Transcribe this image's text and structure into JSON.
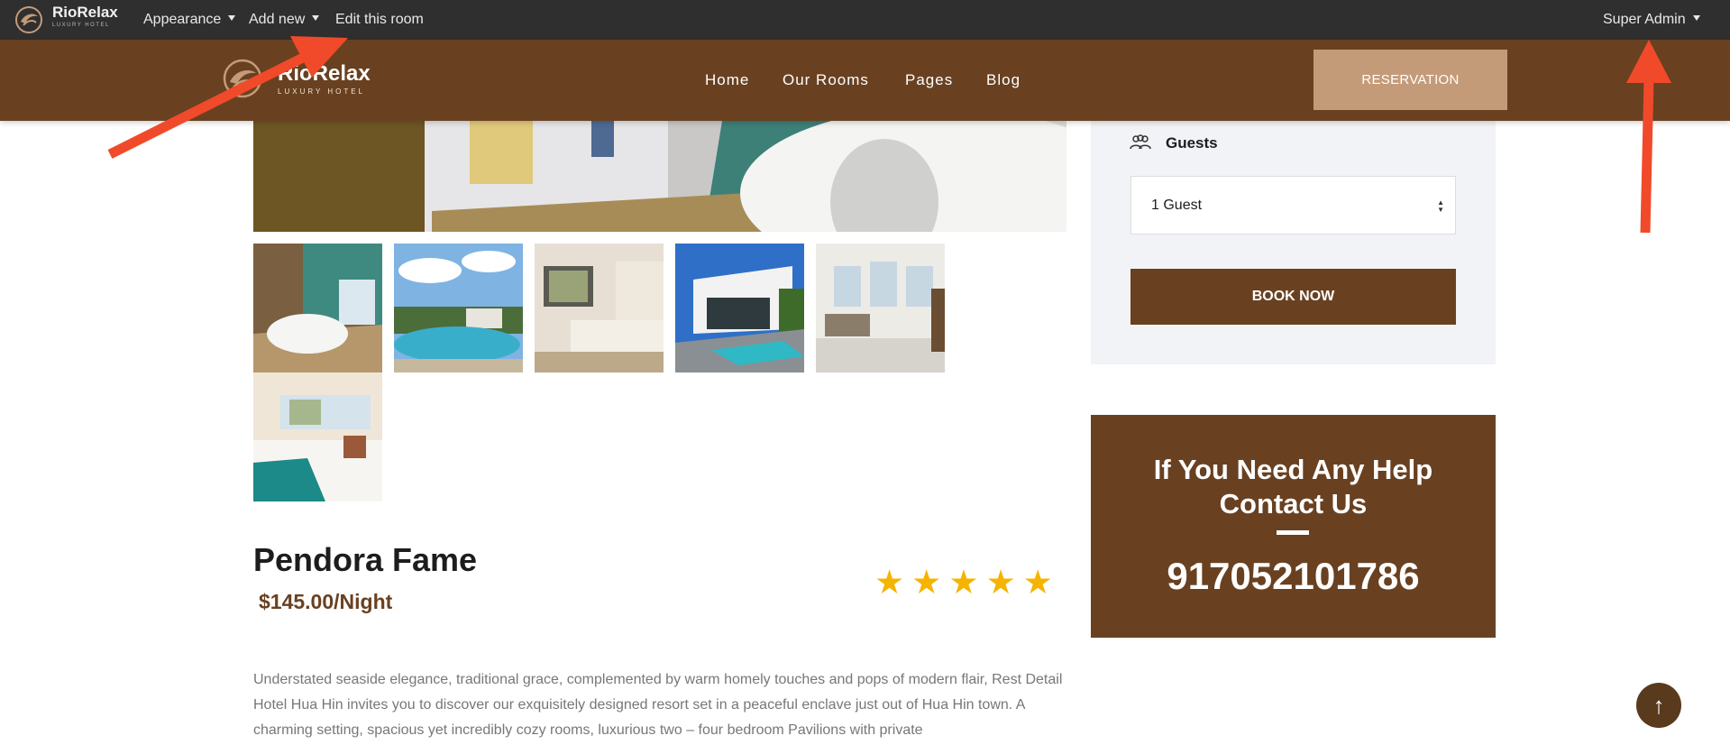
{
  "admin_bar": {
    "brand": "RioRelax",
    "brand_sub": "LUXURY HOTEL",
    "appearance": "Appearance",
    "add_new": "Add new",
    "edit_room": "Edit this room",
    "user": "Super Admin"
  },
  "header": {
    "brand": "RioRelax",
    "brand_sub": "LUXURY HOTEL",
    "nav": [
      "Home",
      "Our Rooms",
      "Pages",
      "Blog"
    ],
    "reservation": "RESERVATION"
  },
  "room": {
    "name": "Pendora Fame",
    "price": "$145.00/Night",
    "rating": 5,
    "stars": "★★★★★",
    "description": "Understated seaside elegance, traditional grace, complemented by warm homely touches and pops of modern flair, Rest Detail Hotel Hua Hin invites you to discover our exquisitely designed resort set in a peaceful enclave just out of Hua Hin town. A charming setting, spacious yet incredibly cozy rooms, luxurious two – four bedroom Pavilions with private"
  },
  "booking": {
    "guests_label": "Guests",
    "guests_value": "1 Guest",
    "book_now": "BOOK NOW"
  },
  "help_box": {
    "title_line1": "If You Need Any Help",
    "title_line2": "Contact Us",
    "phone": "917052101786"
  },
  "colors": {
    "brand_brown": "#694121",
    "accent_tan": "#c49b79",
    "star": "#f5b400",
    "annotation_arrow": "#f04a2a"
  },
  "icons": {
    "back_to_top": "arrow-up-icon",
    "guests": "users-icon"
  }
}
